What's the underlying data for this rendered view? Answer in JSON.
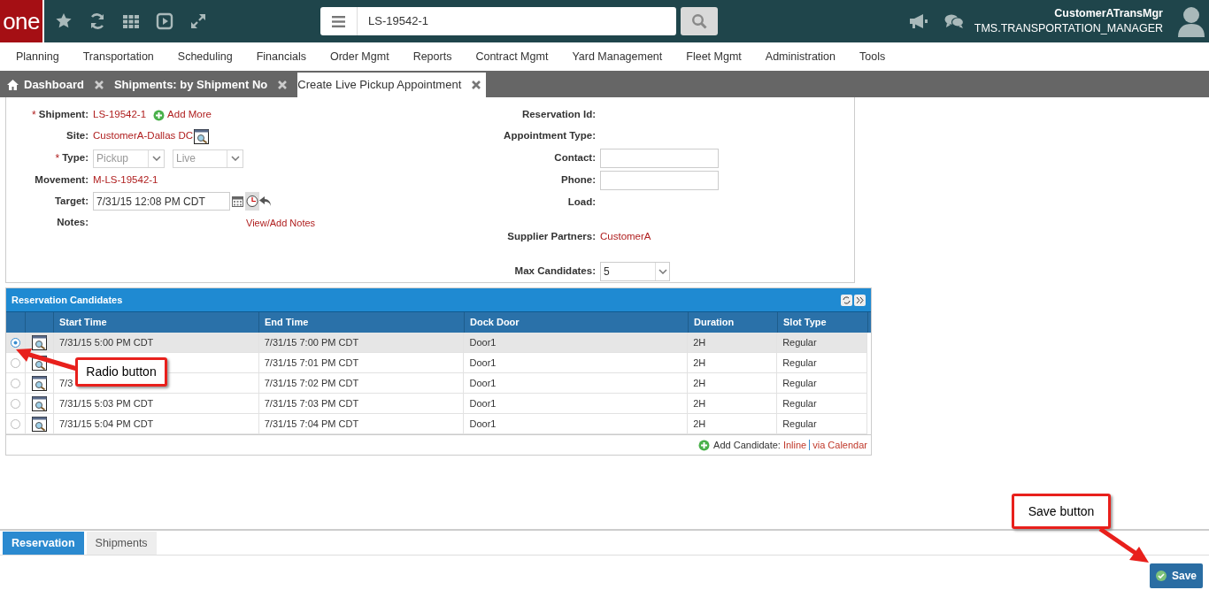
{
  "top_bar": {
    "logo": "one",
    "search_value": "LS-19542-1",
    "user_name": "CustomerATransMgr",
    "user_role": "TMS.TRANSPORTATION_MANAGER"
  },
  "menu": [
    "Planning",
    "Transportation",
    "Scheduling",
    "Financials",
    "Order Mgmt",
    "Reports",
    "Contract Mgmt",
    "Yard Management",
    "Fleet Mgmt",
    "Administration",
    "Tools"
  ],
  "tabs": [
    {
      "label": "Dashboard",
      "kind": "home",
      "selected": false
    },
    {
      "label": "Shipments: by Shipment No",
      "kind": "plain",
      "selected": false
    },
    {
      "label": "Create Live Pickup Appointment",
      "kind": "plain",
      "selected": true
    }
  ],
  "form_left": [
    {
      "label": "Shipment:",
      "required_mark": "*",
      "kind": "link",
      "value": "LS-19542-1",
      "extra": "Add More"
    },
    {
      "label": "Site:",
      "kind": "lookup",
      "value": "CustomerA-Dallas DC"
    },
    {
      "label": "Type:",
      "required_mark": "*",
      "kind": "selects",
      "values": [
        "Pickup",
        "Live"
      ]
    },
    {
      "label": "Movement:",
      "kind": "link",
      "value": "M-LS-19542-1"
    },
    {
      "label": "Target:",
      "kind": "datetime",
      "value": "7/31/15 12:08 PM CDT"
    },
    {
      "label": "Notes:",
      "kind": "notes",
      "value": "View/Add Notes"
    }
  ],
  "form_right": [
    {
      "label": "Reservation Id:",
      "kind": "empty"
    },
    {
      "label": "Appointment Type:",
      "kind": "empty"
    },
    {
      "label": "Contact:",
      "kind": "input"
    },
    {
      "label": "Phone:",
      "kind": "input"
    },
    {
      "label": "Load:",
      "kind": "empty"
    },
    {
      "label": "Supplier Partners:",
      "kind": "link",
      "value": "CustomerA"
    },
    {
      "label": "Max Candidates:",
      "kind": "select",
      "value": "5"
    }
  ],
  "grid": {
    "title": "Reservation Candidates",
    "columns": [
      "Start Time",
      "End Time",
      "Dock Door",
      "Duration",
      "Slot Type"
    ],
    "rows": [
      {
        "selected": true,
        "cells": [
          "7/31/15 5:00 PM CDT",
          "7/31/15 7:00 PM CDT",
          "Door1",
          "2H",
          "Regular"
        ]
      },
      {
        "selected": false,
        "cells": [
          null,
          "7/31/15 7:01 PM CDT",
          "Door1",
          "2H",
          "Regular"
        ]
      },
      {
        "selected": false,
        "cells": [
          "7/3",
          "7/31/15 7:02 PM CDT",
          "Door1",
          "2H",
          "Regular"
        ]
      },
      {
        "selected": false,
        "cells": [
          "7/31/15 5:03 PM CDT",
          "7/31/15 7:03 PM CDT",
          "Door1",
          "2H",
          "Regular"
        ]
      },
      {
        "selected": false,
        "cells": [
          "7/31/15 5:04 PM CDT",
          "7/31/15 7:04 PM CDT",
          "Door1",
          "2H",
          "Regular"
        ]
      }
    ],
    "footer": {
      "label": "Add Candidate:",
      "links": [
        "Inline",
        "via Calendar"
      ]
    }
  },
  "bottom_tabs": [
    {
      "label": "Reservation",
      "selected": true
    },
    {
      "label": "Shipments",
      "selected": false
    }
  ],
  "save_button": "Save",
  "annotations": [
    {
      "text": "Radio button"
    },
    {
      "text": "Save button"
    }
  ]
}
